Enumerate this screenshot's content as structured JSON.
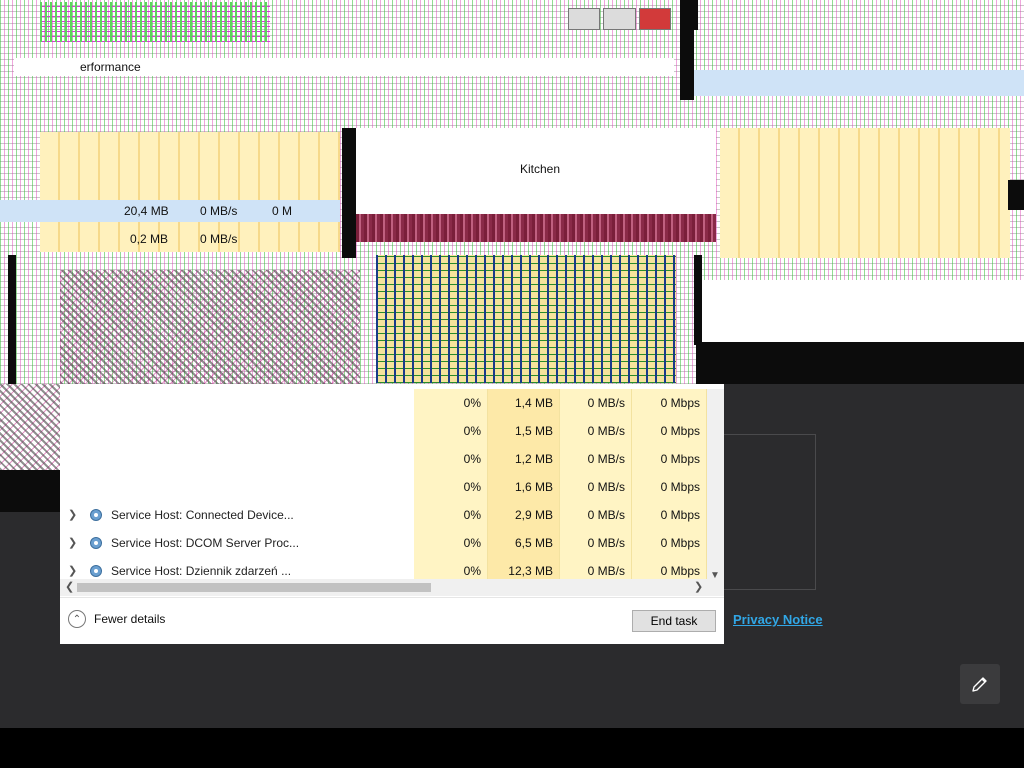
{
  "background_app": {
    "privacy_link": "Privacy Notice",
    "edit_icon": "pencil-icon"
  },
  "glitch": {
    "tab_label": "erformance",
    "row_mem": "20,4 MB",
    "row_disk": "0 MB/s",
    "row_net": "0 M",
    "row2_mem": "0,2 MB",
    "row2_disk": "0 MB/s",
    "ghost_heading": "Kitchen"
  },
  "processes": [
    {
      "name": "",
      "cpu": "0%",
      "memory": "1,4 MB",
      "disk": "0 MB/s",
      "network": "0 Mbps"
    },
    {
      "name": "",
      "cpu": "0%",
      "memory": "1,5 MB",
      "disk": "0 MB/s",
      "network": "0 Mbps"
    },
    {
      "name": "",
      "cpu": "0%",
      "memory": "1,2 MB",
      "disk": "0 MB/s",
      "network": "0 Mbps"
    },
    {
      "name": "",
      "cpu": "0%",
      "memory": "1,6 MB",
      "disk": "0 MB/s",
      "network": "0 Mbps"
    },
    {
      "name": "Service Host: Connected Device...",
      "cpu": "0%",
      "memory": "2,9 MB",
      "disk": "0 MB/s",
      "network": "0 Mbps"
    },
    {
      "name": "Service Host: DCOM Server Proc...",
      "cpu": "0%",
      "memory": "6,5 MB",
      "disk": "0 MB/s",
      "network": "0 Mbps"
    },
    {
      "name": "Service Host: Dziennik zdarzeń ...",
      "cpu": "0%",
      "memory": "12,3 MB",
      "disk": "0 MB/s",
      "network": "0 Mbps"
    }
  ],
  "footer": {
    "fewer_details": "Fewer details",
    "end_task": "End task"
  },
  "icons": {
    "expand": "chevron-right-icon",
    "process": "gear-icon",
    "collapse": "chevron-up-circle-icon"
  },
  "colors": {
    "link": "#31a7e6",
    "heat_light": "#fff4c4",
    "heat_mem": "#fde9a8",
    "dark_bg": "#2b2b2d"
  }
}
